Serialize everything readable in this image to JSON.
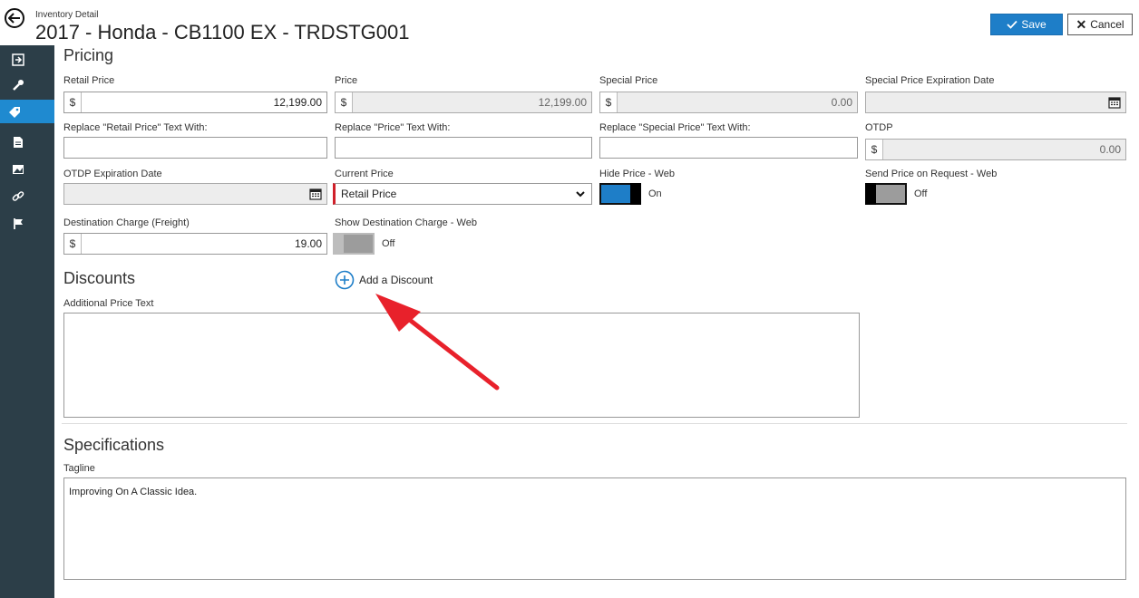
{
  "header": {
    "breadcrumb": "Inventory Detail",
    "title": "2017 - Honda - CB1100 EX - TRDSTG001",
    "save_label": "Save",
    "cancel_label": "Cancel"
  },
  "sidebar": {
    "items": [
      {
        "icon": "exit-icon"
      },
      {
        "icon": "wrench-icon"
      },
      {
        "icon": "tag-icon",
        "active": true
      },
      {
        "icon": "document-icon"
      },
      {
        "icon": "image-icon"
      },
      {
        "icon": "link-icon"
      },
      {
        "icon": "flag-icon"
      }
    ]
  },
  "pricing": {
    "title": "Pricing",
    "retail_price": {
      "label": "Retail Price",
      "prefix": "$",
      "value": "12,199.00"
    },
    "price": {
      "label": "Price",
      "prefix": "$",
      "value": "12,199.00"
    },
    "special_price": {
      "label": "Special Price",
      "prefix": "$",
      "value": "0.00"
    },
    "special_price_exp": {
      "label": "Special Price Expiration Date",
      "value": ""
    },
    "replace_retail": {
      "label": "Replace \"Retail Price\" Text With:",
      "value": ""
    },
    "replace_price": {
      "label": "Replace \"Price\" Text With:",
      "value": ""
    },
    "replace_special": {
      "label": "Replace \"Special Price\" Text With:",
      "value": ""
    },
    "otdp": {
      "label": "OTDP",
      "prefix": "$",
      "value": "0.00"
    },
    "otdp_exp": {
      "label": "OTDP Expiration Date",
      "value": ""
    },
    "current_price": {
      "label": "Current Price",
      "value": "Retail Price"
    },
    "hide_price_web": {
      "label": "Hide Price - Web",
      "state": "On"
    },
    "send_price_request": {
      "label": "Send Price on Request - Web",
      "state": "Off"
    },
    "destination_charge": {
      "label": "Destination Charge (Freight)",
      "prefix": "$",
      "value": "19.00"
    },
    "show_destination": {
      "label": "Show Destination Charge - Web",
      "state": "Off"
    }
  },
  "discounts": {
    "title": "Discounts",
    "add_label": "Add a Discount",
    "additional_text_label": "Additional Price Text",
    "additional_text_value": ""
  },
  "specifications": {
    "title": "Specifications",
    "tagline_label": "Tagline",
    "tagline_value": "Improving On A Classic Idea."
  },
  "colors": {
    "accent": "#1e7ec8",
    "sidebar_bg": "#2c3e48",
    "required_marker": "#d0202a",
    "annotation_arrow": "#e8212b"
  }
}
